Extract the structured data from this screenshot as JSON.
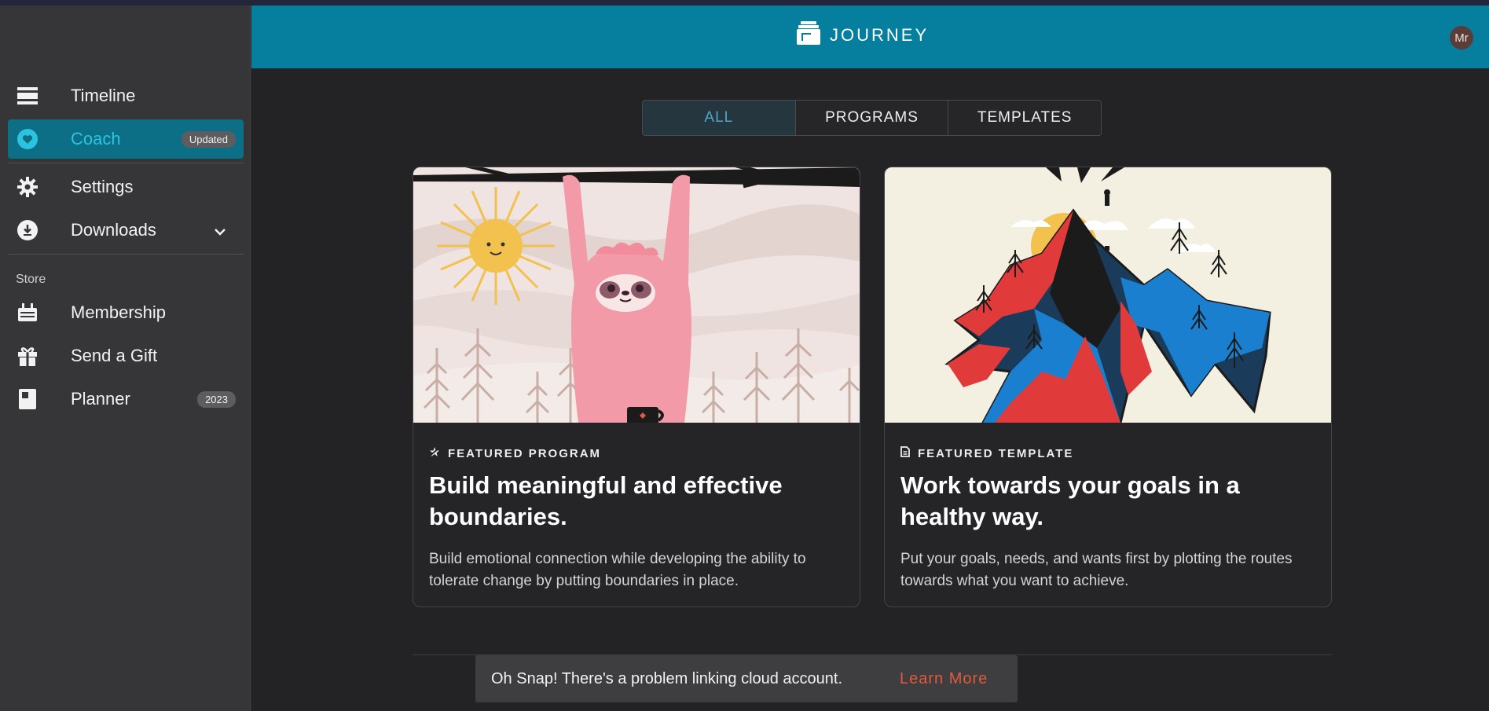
{
  "app": {
    "name": "JOURNEY",
    "avatar_initials": "Mr"
  },
  "sidebar": {
    "items": [
      {
        "label": "Timeline",
        "icon": "timeline-icon"
      },
      {
        "label": "Coach",
        "icon": "heart-icon",
        "badge": "Updated",
        "active": true
      },
      {
        "label": "Settings",
        "icon": "gear-icon"
      },
      {
        "label": "Downloads",
        "icon": "download-icon",
        "expandable": true
      }
    ],
    "store_label": "Store",
    "store_items": [
      {
        "label": "Membership",
        "icon": "membership-icon"
      },
      {
        "label": "Send a Gift",
        "icon": "gift-icon"
      },
      {
        "label": "Planner",
        "icon": "planner-icon",
        "badge": "2023"
      }
    ]
  },
  "tabs": [
    {
      "label": "ALL",
      "active": true
    },
    {
      "label": "PROGRAMS",
      "active": false
    },
    {
      "label": "TEMPLATES",
      "active": false
    }
  ],
  "cards": [
    {
      "kicker": "FEATURED PROGRAM",
      "title": "Build meaningful and effective boundaries.",
      "description": "Build emotional connection while developing the ability to tolerate change by putting boundaries in place."
    },
    {
      "kicker": "FEATURED TEMPLATE",
      "title": "Work towards your goals in a healthy way.",
      "description": "Put your goals, needs, and wants first by plotting the routes towards what you want to achieve."
    }
  ],
  "toast": {
    "message": "Oh Snap! There's a problem linking cloud account.",
    "link": "Learn More"
  },
  "colors": {
    "header": "#067f9f",
    "active_nav": "#0d6f86",
    "accent": "#2cc3e0",
    "toast_link": "#e05a3c"
  }
}
